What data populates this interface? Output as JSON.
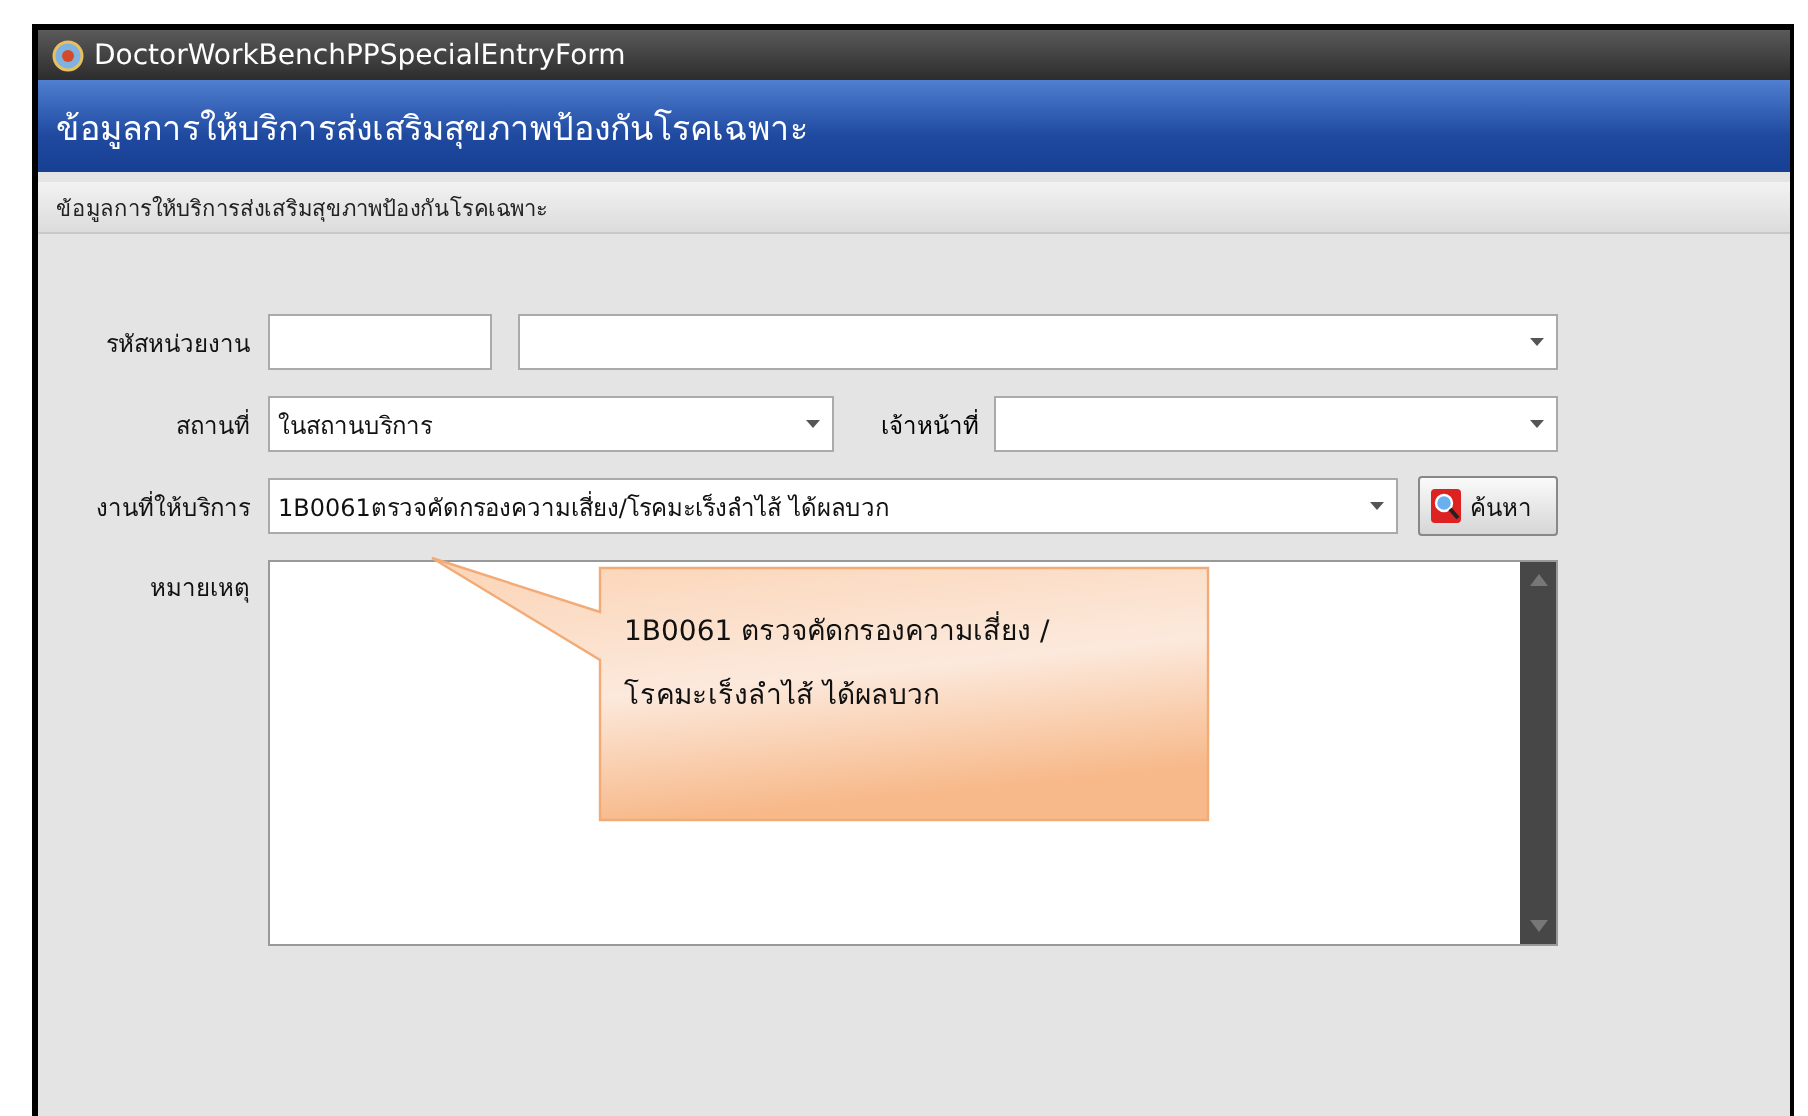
{
  "window": {
    "title": "DoctorWorkBenchPPSpecialEntryForm"
  },
  "header": {
    "title": "ข้อมูลการให้บริการส่งเสริมสุขภาพป้องกันโรคเฉพาะ"
  },
  "section": {
    "title": "ข้อมูลการให้บริการส่งเสริมสุขภาพป้องกันโรคเฉพาะ"
  },
  "form": {
    "rows": [
      {
        "label": "รหัสหน่วยงาน",
        "controls": [
          {
            "kind": "text"
          },
          {
            "kind": "combo"
          }
        ]
      },
      {
        "label": "สถานที่",
        "controls": [
          {
            "kind": "combo",
            "value": "ในสถานบริการ"
          },
          {
            "kind": "label",
            "text": "เจ้าหน้าที่"
          },
          {
            "kind": "combo"
          }
        ]
      },
      {
        "label": "งานที่ให้บริการ",
        "controls": [
          {
            "kind": "combo",
            "value": "1B0061ตรวจคัดกรองความเสี่ยง/โรคมะเร็งลำไส้ ได้ผลบวก"
          },
          {
            "kind": "button",
            "label": "ค้นหา"
          }
        ]
      },
      {
        "label": "หมายเหตุ",
        "controls": [
          {
            "kind": "textarea"
          }
        ]
      }
    ]
  },
  "callout": {
    "lines": [
      "1B0061 ตรวจคัดกรองความเสี่ยง /",
      "โรคมะเร็งลำไส้ ได้ผลบวก"
    ]
  }
}
